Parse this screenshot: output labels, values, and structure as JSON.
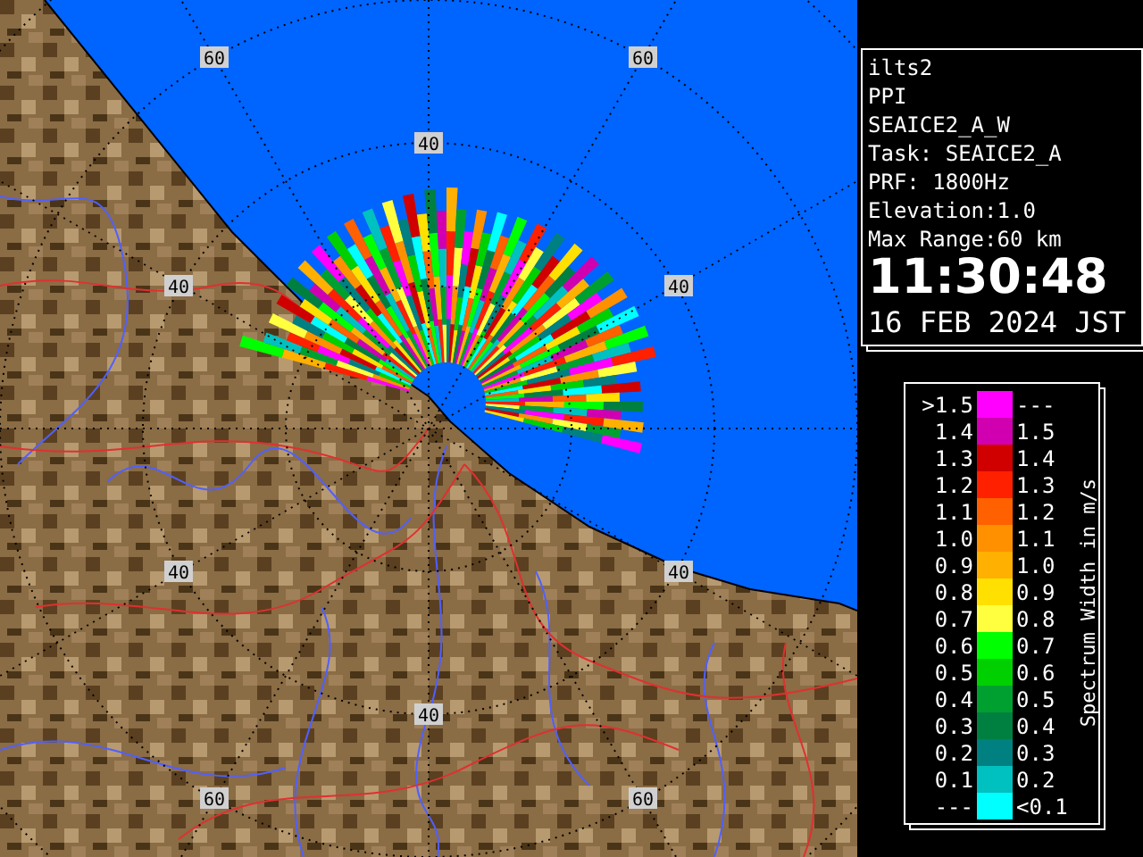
{
  "map": {
    "range_labels": [
      "60",
      "60",
      "40",
      "40",
      "40",
      "40",
      "40",
      "40",
      "60",
      "60"
    ]
  },
  "info": {
    "lines": [
      "ilts2",
      "PPI",
      "SEAICE2_A_W",
      "Task: SEAICE2_A",
      "PRF: 1800Hz",
      "Elevation:1.0",
      "Max Range:60 km"
    ],
    "time": "11:30:48",
    "date": "16 FEB 2024 JST"
  },
  "legend": {
    "title": "Spectrum Width in m/s",
    "rows": [
      {
        "low": ">1.5",
        "high": "---",
        "color": "#ff00ff"
      },
      {
        "low": "1.4",
        "high": "1.5",
        "color": "#d000b0"
      },
      {
        "low": "1.3",
        "high": "1.4",
        "color": "#d00000"
      },
      {
        "low": "1.2",
        "high": "1.3",
        "color": "#ff2000"
      },
      {
        "low": "1.1",
        "high": "1.2",
        "color": "#ff6000"
      },
      {
        "low": "1.0",
        "high": "1.1",
        "color": "#ff9000"
      },
      {
        "low": "0.9",
        "high": "1.0",
        "color": "#ffb000"
      },
      {
        "low": "0.8",
        "high": "0.9",
        "color": "#ffe000"
      },
      {
        "low": "0.7",
        "high": "0.8",
        "color": "#ffff40"
      },
      {
        "low": "0.6",
        "high": "0.7",
        "color": "#00ff00"
      },
      {
        "low": "0.5",
        "high": "0.6",
        "color": "#00d000"
      },
      {
        "low": "0.4",
        "high": "0.5",
        "color": "#00a030"
      },
      {
        "low": "0.3",
        "high": "0.4",
        "color": "#008040"
      },
      {
        "low": "0.2",
        "high": "0.3",
        "color": "#008080"
      },
      {
        "low": "0.1",
        "high": "0.2",
        "color": "#00c0c0"
      },
      {
        "low": "---",
        "high": "<0.1",
        "color": "#00ffff"
      }
    ]
  }
}
